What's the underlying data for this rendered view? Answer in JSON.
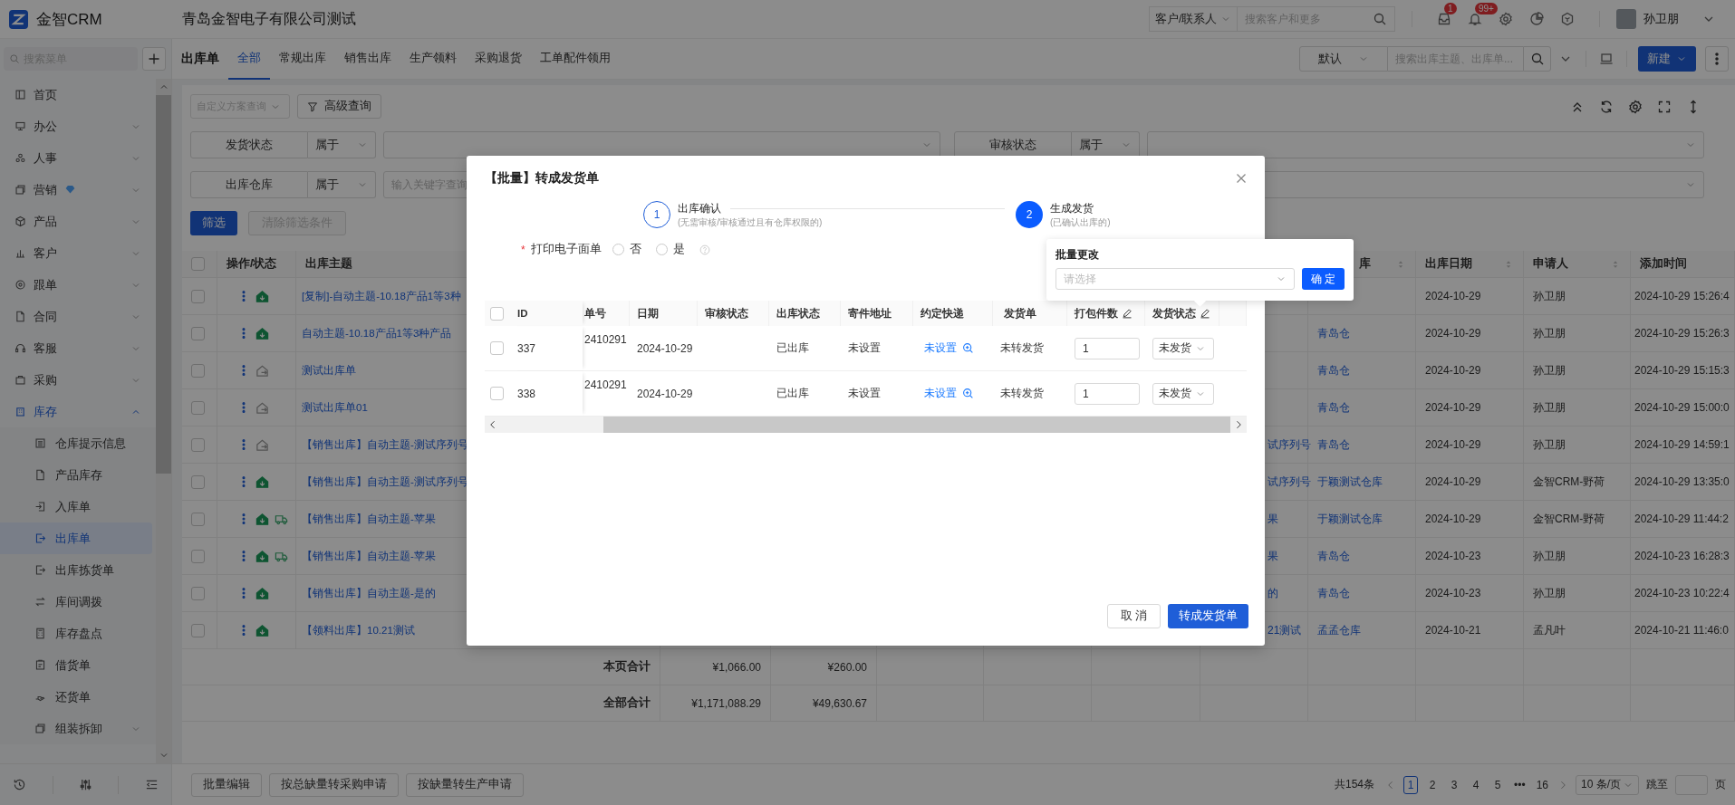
{
  "topbar": {
    "product": "金智CRM",
    "company": "青岛金智电子有限公司测试",
    "search_scope": "客户/联系人",
    "search": {
      "placeholder": "搜索客户和更多"
    },
    "notifications": [
      {
        "count": "1"
      },
      {
        "count": "99+"
      }
    ],
    "user": {
      "name": "孙卫朋"
    }
  },
  "sidebar": {
    "search": {
      "placeholder": "搜索菜单"
    },
    "items": [
      {
        "label": "首页",
        "selected": false
      },
      {
        "label": "办公",
        "selected": false,
        "expanded": false
      },
      {
        "label": "人事",
        "selected": false,
        "expanded": false
      },
      {
        "label": "营销",
        "selected": false,
        "expanded": false
      },
      {
        "label": "产品",
        "selected": false,
        "expanded": false
      },
      {
        "label": "客户",
        "selected": false,
        "expanded": false
      },
      {
        "label": "跟单",
        "selected": false,
        "expanded": false
      },
      {
        "label": "合同",
        "selected": false,
        "expanded": false
      },
      {
        "label": "客服",
        "selected": false,
        "expanded": false
      },
      {
        "label": "采购",
        "selected": false,
        "expanded": false
      },
      {
        "label": "库存",
        "selected": false,
        "expanded": true,
        "children": [
          {
            "label": "仓库提示信息",
            "selected": false
          },
          {
            "label": "产品库存",
            "selected": false
          },
          {
            "label": "入库单",
            "selected": false
          },
          {
            "label": "出库单",
            "selected": true
          },
          {
            "label": "出库拣货单",
            "selected": false
          },
          {
            "label": "库间调拨",
            "selected": false
          },
          {
            "label": "库存盘点",
            "selected": false
          },
          {
            "label": "借货单",
            "selected": false
          },
          {
            "label": "还货单",
            "selected": false
          },
          {
            "label": "组装拆卸",
            "selected": false,
            "expanded": false
          }
        ]
      }
    ]
  },
  "page": {
    "title": "出库单",
    "tabs": [
      {
        "label": "全部",
        "selected": true
      },
      {
        "label": "常规出库",
        "selected": false
      },
      {
        "label": "销售出库",
        "selected": false
      },
      {
        "label": "生产领料",
        "selected": false
      },
      {
        "label": "采购退货",
        "selected": false
      },
      {
        "label": "工单配件领用",
        "selected": false
      }
    ],
    "view": "默认",
    "search": {
      "placeholder": "搜索出库主题、出库单..."
    },
    "new_button": "新建"
  },
  "filters": {
    "scheme": {
      "placeholder": "自定义方案查询"
    },
    "advanced": "高级查询",
    "conditions": [
      {
        "field": "发货状态",
        "operator": "属于",
        "kind": "select"
      },
      {
        "field": "审核状态",
        "operator": "属于",
        "kind": "select"
      },
      {
        "field": "出库仓库",
        "operator": "属于",
        "kind": "input",
        "placeholder": "输入关键字查询"
      },
      {
        "kind": "select"
      }
    ],
    "apply": "筛选",
    "clear": {
      "label": "清除筛选条件",
      "disabled": true
    }
  },
  "table": {
    "header": {
      "operation": "操作/状态",
      "subject": "出库主题",
      "warehouse": "库",
      "date": "出库日期",
      "applicant": "申请人",
      "added": "添加时间"
    },
    "all_checked": false,
    "rows": [
      {
        "checked": false,
        "outbound": true,
        "delivery": false,
        "subject": "[复制]-自动主题-10.18产品1等3种",
        "date": "2024-10-29",
        "applicant": "孙卫朋",
        "added": "2024-10-29 15:26:4"
      },
      {
        "checked": false,
        "outbound": true,
        "delivery": false,
        "subject": "自动主题-10.18产品1等3种产品",
        "warehouse": "青岛仓",
        "date": "2024-10-29",
        "applicant": "孙卫朋",
        "added": "2024-10-29 15:26:3"
      },
      {
        "checked": false,
        "outbound": false,
        "delivery": false,
        "subject": "测试出库单",
        "warehouse": "青岛仓",
        "date": "2024-10-29",
        "applicant": "孙卫朋",
        "added": "2024-10-29 15:15:3"
      },
      {
        "checked": false,
        "outbound": false,
        "delivery": false,
        "subject": "测试出库单01",
        "warehouse": "青岛仓",
        "date": "2024-10-29",
        "applicant": "孙卫朋",
        "added": "2024-10-29 15:00:0"
      },
      {
        "checked": false,
        "outbound": false,
        "delivery": false,
        "subject": "【销售出库】自动主题-测试序列号",
        "column_5": "试序列号",
        "warehouse": "青岛仓",
        "date": "2024-10-29",
        "applicant": "孙卫朋",
        "added": "2024-10-29 14:59:1"
      },
      {
        "checked": false,
        "outbound": true,
        "delivery": false,
        "subject": "【销售出库】自动主题-测试序列号",
        "column_5": "试序列号",
        "warehouse": "于颖测试仓库",
        "date": "2024-10-29",
        "applicant": "金智CRM-野荷",
        "added": "2024-10-29 13:35:0"
      },
      {
        "checked": false,
        "outbound": true,
        "delivery": true,
        "subject": "【销售出库】自动主题-苹果",
        "column_5": "果",
        "warehouse": "于颖测试仓库",
        "date": "2024-10-29",
        "applicant": "金智CRM-野荷",
        "added": "2024-10-29 11:44:2"
      },
      {
        "checked": false,
        "outbound": true,
        "delivery": true,
        "subject": "【销售出库】自动主题-苹果",
        "column_5": "果",
        "warehouse": "青岛仓",
        "date": "2024-10-23",
        "applicant": "孙卫朋",
        "added": "2024-10-23 16:28:3"
      },
      {
        "checked": false,
        "outbound": true,
        "delivery": false,
        "subject": "【销售出库】自动主题-是的",
        "column_5": "的",
        "warehouse": "青岛仓",
        "date": "2024-10-23",
        "applicant": "孙卫朋",
        "added": "2024-10-23 10:22:4"
      },
      {
        "checked": false,
        "outbound": true,
        "delivery": false,
        "subject": "【领料出库】10.21测试",
        "column_5": "21测试",
        "warehouse": "孟孟仓库",
        "date": "2024-10-21",
        "applicant": "孟凡叶",
        "added": "2024-10-21 11:46:0"
      }
    ],
    "totals": [
      {
        "label": "本页合计",
        "amount_1": "¥1,066.00",
        "amount_2": "¥260.00"
      },
      {
        "label": "全部合计",
        "amount_1": "¥1,171,088.29",
        "amount_2": "¥49,630.67"
      }
    ]
  },
  "actions": [
    "批量编辑",
    "按总缺量转采购申请",
    "按缺量转生产申请"
  ],
  "pagination": {
    "total": "共154条",
    "pages": [
      {
        "label": "1",
        "selected": true
      },
      {
        "label": "2",
        "selected": false
      },
      {
        "label": "3",
        "selected": false
      },
      {
        "label": "4",
        "selected": false
      },
      {
        "label": "5",
        "selected": false
      },
      {
        "label": "•••",
        "selected": false
      },
      {
        "label": "16",
        "selected": false
      }
    ],
    "page_size": "10 条/页",
    "jump_label": "跳至",
    "jump_unit": "页"
  },
  "modal": {
    "title": "【批量】转成发货单",
    "steps": [
      {
        "number": "1",
        "title": "出库确认",
        "description": "(无需审核/审核通过且有仓库权限的)",
        "active": false
      },
      {
        "number": "2",
        "title": "生成发货",
        "description": "(已确认出库的)",
        "active": true
      }
    ],
    "print_label": {
      "required_mark": "*",
      "label": "打印电子面单",
      "options": [
        {
          "label": "否",
          "selected": false
        },
        {
          "label": "是",
          "selected": false
        }
      ]
    },
    "table": {
      "all_checked": false,
      "columns": [
        {
          "label": "ID",
          "editable": false
        },
        {
          "label": "单号",
          "editable": false
        },
        {
          "label": "日期",
          "editable": false
        },
        {
          "label": "审核状态",
          "editable": false
        },
        {
          "label": "出库状态",
          "editable": false
        },
        {
          "label": "寄件地址",
          "editable": false
        },
        {
          "label": "约定快递",
          "editable": false
        },
        {
          "label": "发货单",
          "editable": false
        },
        {
          "label": "打包件数",
          "editable": true
        },
        {
          "label": "发货状态",
          "editable": true
        }
      ],
      "rows": [
        {
          "checked": false,
          "id": "337",
          "order_no": "2410291",
          "date": "2024-10-29",
          "outbound_status": "已出库",
          "sender_address": "未设置",
          "courier": "未设置",
          "delivery_note": "未转发货",
          "packages": "1",
          "shipping_status": "未发货"
        },
        {
          "checked": false,
          "id": "338",
          "order_no": "2410291",
          "date": "2024-10-29",
          "outbound_status": "已出库",
          "sender_address": "未设置",
          "courier": "未设置",
          "delivery_note": "未转发货",
          "packages": "1",
          "shipping_status": "未发货"
        }
      ]
    },
    "cancel": "取 消",
    "confirm": "转成发货单",
    "popover": {
      "title": "批量更改",
      "placeholder": "请选择",
      "confirm": "确 定"
    }
  }
}
